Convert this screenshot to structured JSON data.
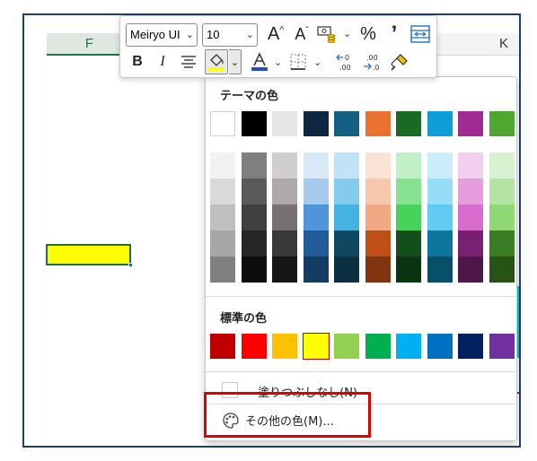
{
  "sheet": {
    "column_f": "F",
    "column_k": "K"
  },
  "toolbar": {
    "font_name": "Meiryo UI",
    "font_size": "10",
    "buttons": [
      {
        "name": "increase-font-size",
        "glyph": "Aˆ"
      },
      {
        "name": "decrease-font-size",
        "glyph": "Aˇ"
      },
      {
        "name": "accounting-format",
        "glyph": "₤"
      },
      {
        "name": "percent-style",
        "glyph": "%"
      },
      {
        "name": "comma-style",
        "glyph": "’"
      },
      {
        "name": "merge-center",
        "glyph": "⇔"
      },
      {
        "name": "bold",
        "glyph": "B"
      },
      {
        "name": "italic",
        "glyph": "I"
      },
      {
        "name": "align-center",
        "glyph": "≡"
      },
      {
        "name": "fill-color",
        "glyph": "◇"
      },
      {
        "name": "font-color",
        "glyph": "A"
      },
      {
        "name": "borders",
        "glyph": "⊞"
      },
      {
        "name": "decrease-decimal",
        "glyph": ".00"
      },
      {
        "name": "increase-decimal",
        "glyph": ".0"
      },
      {
        "name": "format-painter",
        "glyph": "✎"
      }
    ]
  },
  "palette": {
    "theme_title": "テーマの色",
    "theme_top": [
      "#ffffff",
      "#000000",
      "#e7e6e6",
      "#0e2841",
      "#156082",
      "#e97132",
      "#196b24",
      "#0f9ed5",
      "#a02b93",
      "#4ea72e"
    ],
    "theme_shades": [
      [
        "#f2f2f2",
        "#d9d9d9",
        "#bfbfbf",
        "#a6a6a6",
        "#808080"
      ],
      [
        "#7f7f7f",
        "#595959",
        "#404040",
        "#262626",
        "#0d0d0d"
      ],
      [
        "#d0cece",
        "#aeaaaa",
        "#757171",
        "#3a3838",
        "#171616"
      ],
      [
        "#dae9f8",
        "#a6c9ec",
        "#4e95d9",
        "#215c98",
        "#153d64"
      ],
      [
        "#c0e4f5",
        "#83cceb",
        "#44b3e1",
        "#104862",
        "#0b3041"
      ],
      [
        "#fbe2d5",
        "#f7c7ac",
        "#f1a983",
        "#c04f15",
        "#803510"
      ],
      [
        "#c1f0c8",
        "#84e291",
        "#47d359",
        "#124f1a",
        "#0a3511"
      ],
      [
        "#caedfb",
        "#95dcf7",
        "#61cbf4",
        "#0c769e",
        "#084f6a"
      ],
      [
        "#f2cfee",
        "#e49edd",
        "#d86dcd",
        "#782170",
        "#4f164a"
      ],
      [
        "#d8f1d1",
        "#b3e4a5",
        "#8ed973",
        "#3b7d23",
        "#275317"
      ]
    ],
    "standard_title": "標準の色",
    "standard": [
      "#c00000",
      "#ff0000",
      "#ffc000",
      "#ffff00",
      "#92d050",
      "#00b050",
      "#00b0f0",
      "#0070c0",
      "#002060",
      "#7030a0"
    ],
    "selected_standard_index": 3,
    "no_fill_label": "塗りつぶしなし(N)",
    "more_colors_label": "その他の色(M)..."
  }
}
